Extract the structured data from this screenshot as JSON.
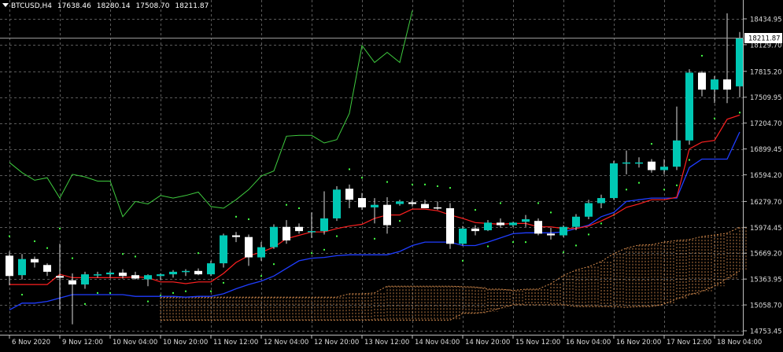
{
  "header": {
    "symbol": "BTCUSD,H4",
    "open": "17638.46",
    "high": "18280.14",
    "low": "17508.70",
    "close": "18211.87"
  },
  "current_price_label": "18211.87",
  "colors": {
    "background": "#000000",
    "grid": "#5a5a5a",
    "bull_candle": "#00c8b4",
    "bear_candle": "#ffffff",
    "wick": "#dddddd",
    "tenkan": "#ff2020",
    "kijun": "#1f3dff",
    "chikou": "#3fcc3f",
    "cloud": "#d88d4e",
    "dots": "#44ff44",
    "axis_text": "#dddddd"
  },
  "chart_data": {
    "type": "candlestick",
    "instrument": "BTCUSD",
    "timeframe": "H4",
    "ylim": [
      14753.45,
      18650
    ],
    "y_ticks": [
      18434.95,
      18129.7,
      17815.2,
      17509.95,
      17204.7,
      16899.45,
      16594.2,
      16279.7,
      15974.45,
      15669.2,
      15363.95,
      15058.7,
      14753.45
    ],
    "y_tick_labels": [
      "18434.95",
      "18129.70",
      "17815.20",
      "17509.95",
      "17204.70",
      "16899.45",
      "16594.20",
      "16279.70",
      "15974.45",
      "15669.20",
      "15363.95",
      "15058.70",
      "14753.45"
    ],
    "x_ticks": [
      {
        "bar": 0,
        "label": "6 Nov 2020"
      },
      {
        "bar": 4,
        "label": "9 Nov 12:00"
      },
      {
        "bar": 8,
        "label": "10 Nov 04:00"
      },
      {
        "bar": 12,
        "label": "10 Nov 20:00"
      },
      {
        "bar": 16,
        "label": "11 Nov 12:00"
      },
      {
        "bar": 20,
        "label": "12 Nov 04:00"
      },
      {
        "bar": 24,
        "label": "12 Nov 20:00"
      },
      {
        "bar": 28,
        "label": "13 Nov 12:00"
      },
      {
        "bar": 32,
        "label": "14 Nov 04:00"
      },
      {
        "bar": 36,
        "label": "14 Nov 20:00"
      },
      {
        "bar": 40,
        "label": "15 Nov 12:00"
      },
      {
        "bar": 44,
        "label": "16 Nov 04:00"
      },
      {
        "bar": 48,
        "label": "16 Nov 20:00"
      },
      {
        "bar": 52,
        "label": "17 Nov 12:00"
      },
      {
        "bar": 56,
        "label": "18 Nov 04:00"
      }
    ],
    "current_price": 18211.87,
    "candles": [
      {
        "o": 15640,
        "h": 15690,
        "l": 15290,
        "c": 15400
      },
      {
        "o": 15410,
        "h": 15660,
        "l": 15360,
        "c": 15600
      },
      {
        "o": 15600,
        "h": 15630,
        "l": 15500,
        "c": 15560
      },
      {
        "o": 15530,
        "h": 15550,
        "l": 15400,
        "c": 15450
      },
      {
        "o": 15400,
        "h": 15780,
        "l": 15000,
        "c": 15380
      },
      {
        "o": 15350,
        "h": 15430,
        "l": 14830,
        "c": 15300
      },
      {
        "o": 15300,
        "h": 15450,
        "l": 15250,
        "c": 15420
      },
      {
        "o": 15410,
        "h": 15450,
        "l": 15380,
        "c": 15420
      },
      {
        "o": 15420,
        "h": 15460,
        "l": 15380,
        "c": 15440
      },
      {
        "o": 15440,
        "h": 15480,
        "l": 15370,
        "c": 15400
      },
      {
        "o": 15410,
        "h": 15450,
        "l": 15360,
        "c": 15370
      },
      {
        "o": 15360,
        "h": 15420,
        "l": 15280,
        "c": 15410
      },
      {
        "o": 15400,
        "h": 15430,
        "l": 15350,
        "c": 15420
      },
      {
        "o": 15420,
        "h": 15470,
        "l": 15380,
        "c": 15450
      },
      {
        "o": 15450,
        "h": 15480,
        "l": 15400,
        "c": 15460
      },
      {
        "o": 15460,
        "h": 15490,
        "l": 15410,
        "c": 15420
      },
      {
        "o": 15420,
        "h": 15580,
        "l": 15400,
        "c": 15550
      },
      {
        "o": 15550,
        "h": 15900,
        "l": 15500,
        "c": 15880
      },
      {
        "o": 15880,
        "h": 15920,
        "l": 15800,
        "c": 15860
      },
      {
        "o": 15860,
        "h": 15890,
        "l": 15520,
        "c": 15620
      },
      {
        "o": 15620,
        "h": 15800,
        "l": 15580,
        "c": 15740
      },
      {
        "o": 15740,
        "h": 16010,
        "l": 15720,
        "c": 15980
      },
      {
        "o": 15980,
        "h": 16060,
        "l": 15780,
        "c": 15820
      },
      {
        "o": 15980,
        "h": 16020,
        "l": 15900,
        "c": 15930
      },
      {
        "o": 15930,
        "h": 16150,
        "l": 15850,
        "c": 15930
      },
      {
        "o": 15930,
        "h": 16400,
        "l": 15890,
        "c": 16080
      },
      {
        "o": 16080,
        "h": 16460,
        "l": 16050,
        "c": 16420
      },
      {
        "o": 16430,
        "h": 16480,
        "l": 16200,
        "c": 16300
      },
      {
        "o": 16320,
        "h": 16380,
        "l": 16180,
        "c": 16210
      },
      {
        "o": 16210,
        "h": 16320,
        "l": 16020,
        "c": 16240
      },
      {
        "o": 16240,
        "h": 16330,
        "l": 15900,
        "c": 16000
      },
      {
        "o": 16250,
        "h": 16300,
        "l": 16230,
        "c": 16280
      },
      {
        "o": 16270,
        "h": 16300,
        "l": 16220,
        "c": 16250
      },
      {
        "o": 16250,
        "h": 16300,
        "l": 16200,
        "c": 16200
      },
      {
        "o": 16210,
        "h": 16280,
        "l": 16180,
        "c": 16200
      },
      {
        "o": 16200,
        "h": 16260,
        "l": 15720,
        "c": 15780
      },
      {
        "o": 15780,
        "h": 15990,
        "l": 15760,
        "c": 15960
      },
      {
        "o": 15960,
        "h": 16000,
        "l": 15880,
        "c": 15930
      },
      {
        "o": 15940,
        "h": 16060,
        "l": 15930,
        "c": 16030
      },
      {
        "o": 16030,
        "h": 16080,
        "l": 15970,
        "c": 16000
      },
      {
        "o": 16000,
        "h": 16040,
        "l": 15980,
        "c": 16030
      },
      {
        "o": 16040,
        "h": 16120,
        "l": 15980,
        "c": 16070
      },
      {
        "o": 16050,
        "h": 16080,
        "l": 15880,
        "c": 15900
      },
      {
        "o": 15900,
        "h": 15970,
        "l": 15830,
        "c": 15880
      },
      {
        "o": 15880,
        "h": 16000,
        "l": 15860,
        "c": 15980
      },
      {
        "o": 15980,
        "h": 16130,
        "l": 15940,
        "c": 16100
      },
      {
        "o": 16100,
        "h": 16300,
        "l": 16070,
        "c": 16260
      },
      {
        "o": 16260,
        "h": 16360,
        "l": 16200,
        "c": 16320
      },
      {
        "o": 16320,
        "h": 16760,
        "l": 16300,
        "c": 16730
      },
      {
        "o": 16730,
        "h": 16880,
        "l": 16600,
        "c": 16740
      },
      {
        "o": 16740,
        "h": 16800,
        "l": 16680,
        "c": 16740
      },
      {
        "o": 16750,
        "h": 16780,
        "l": 16620,
        "c": 16650
      },
      {
        "o": 16650,
        "h": 16780,
        "l": 16600,
        "c": 16690
      },
      {
        "o": 16690,
        "h": 17400,
        "l": 16650,
        "c": 17000
      },
      {
        "o": 17000,
        "h": 17840,
        "l": 16950,
        "c": 17800
      },
      {
        "o": 17800,
        "h": 17820,
        "l": 17520,
        "c": 17600
      },
      {
        "o": 17600,
        "h": 17760,
        "l": 17440,
        "c": 17720
      },
      {
        "o": 17720,
        "h": 18500,
        "l": 17440,
        "c": 17600
      },
      {
        "o": 17638.46,
        "h": 18280.14,
        "l": 17508.7,
        "c": 18211.87
      }
    ],
    "tenkan_sen": [
      15300,
      15300,
      15300,
      15300,
      15420,
      15380,
      15380,
      15380,
      15380,
      15380,
      15390,
      15380,
      15330,
      15330,
      15310,
      15330,
      15330,
      15430,
      15560,
      15640,
      15680,
      15740,
      15840,
      15880,
      15920,
      15920,
      15960,
      15990,
      16010,
      16080,
      16120,
      16120,
      16190,
      16190,
      16170,
      16120,
      16080,
      16030,
      16020,
      16010,
      16020,
      16020,
      15980,
      15980,
      15960,
      15960,
      15990,
      16050,
      16120,
      16210,
      16250,
      16300,
      16300,
      16330,
      16900,
      16980,
      17000,
      17250,
      17300
    ],
    "kijun_sen": [
      15000,
      15080,
      15080,
      15100,
      15140,
      15180,
      15180,
      15180,
      15180,
      15180,
      15160,
      15160,
      15160,
      15160,
      15150,
      15160,
      15160,
      15190,
      15250,
      15300,
      15340,
      15400,
      15490,
      15580,
      15610,
      15620,
      15640,
      15650,
      15650,
      15650,
      15650,
      15690,
      15760,
      15800,
      15800,
      15800,
      15760,
      15760,
      15800,
      15850,
      15900,
      15910,
      15910,
      15910,
      15920,
      15960,
      16000,
      16100,
      16150,
      16280,
      16300,
      16320,
      16320,
      16320,
      16680,
      16780,
      16780,
      16780,
      17100
    ]
  }
}
